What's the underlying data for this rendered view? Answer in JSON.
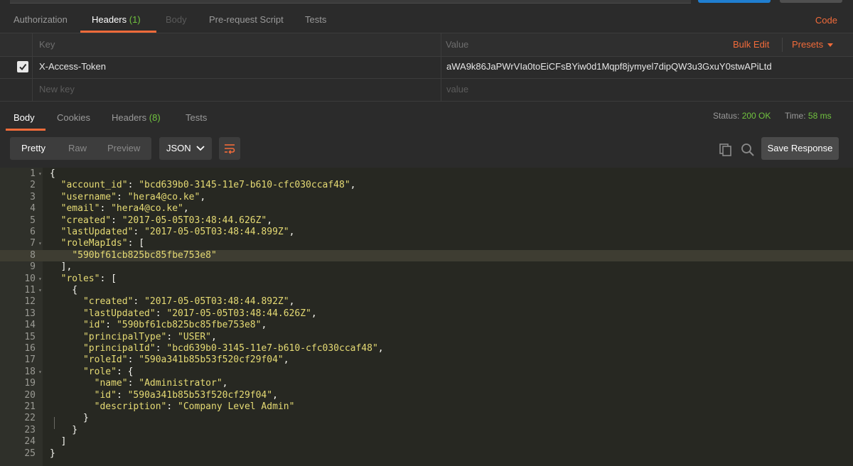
{
  "request_tabs": [
    {
      "label": "Authorization"
    },
    {
      "label": "Headers",
      "count": "(1)"
    },
    {
      "label": "Body"
    },
    {
      "label": "Pre-request Script"
    },
    {
      "label": "Tests"
    }
  ],
  "code_link": "Code",
  "headers_table": {
    "key_header": "Key",
    "value_header": "Value",
    "bulk_edit": "Bulk Edit",
    "presets": "Presets",
    "row": {
      "key": "X-Access-Token",
      "value": "aWA9k86JaPWrVIa0toEiCFsBYiw0d1Mqpf8jymyel7dipQW3u3GxuY0stwAPiLtd",
      "checked": true
    },
    "new_key_placeholder": "New key",
    "new_value_placeholder": "value"
  },
  "response_tabs": [
    {
      "label": "Body"
    },
    {
      "label": "Cookies"
    },
    {
      "label": "Headers",
      "count": "(8)"
    },
    {
      "label": "Tests"
    }
  ],
  "status": {
    "status_label": "Status:",
    "status_value": "200 OK",
    "time_label": "Time:",
    "time_value": "58 ms"
  },
  "view_modes": [
    "Pretty",
    "Raw",
    "Preview"
  ],
  "format": "JSON",
  "save_response": "Save Response",
  "colors": {
    "accent": "#f26b3a",
    "success": "#71c33f"
  },
  "response_lines": [
    "{",
    "  \"account_id\": \"bcd639b0-3145-11e7-b610-cfc030ccaf48\",",
    "  \"username\": \"hera4@co.ke\",",
    "  \"email\": \"hera4@co.ke\",",
    "  \"created\": \"2017-05-05T03:48:44.626Z\",",
    "  \"lastUpdated\": \"2017-05-05T03:48:44.899Z\",",
    "  \"roleMapIds\": [",
    "    \"590bf61cb825bc85fbe753e8\"",
    "  ],",
    "  \"roles\": [",
    "    {",
    "      \"created\": \"2017-05-05T03:48:44.892Z\",",
    "      \"lastUpdated\": \"2017-05-05T03:48:44.626Z\",",
    "      \"id\": \"590bf61cb825bc85fbe753e8\",",
    "      \"principalType\": \"USER\",",
    "      \"principalId\": \"bcd639b0-3145-11e7-b610-cfc030ccaf48\",",
    "      \"roleId\": \"590a341b85b53f520cf29f04\",",
    "      \"role\": {",
    "        \"name\": \"Administrator\",",
    "        \"id\": \"590a341b85b53f520cf29f04\",",
    "        \"description\": \"Company Level Admin\"",
    "      }",
    "    }",
    "  ]",
    "}"
  ],
  "foldable_lines": [
    1,
    7,
    10,
    11,
    18
  ],
  "highlighted_line": 8
}
